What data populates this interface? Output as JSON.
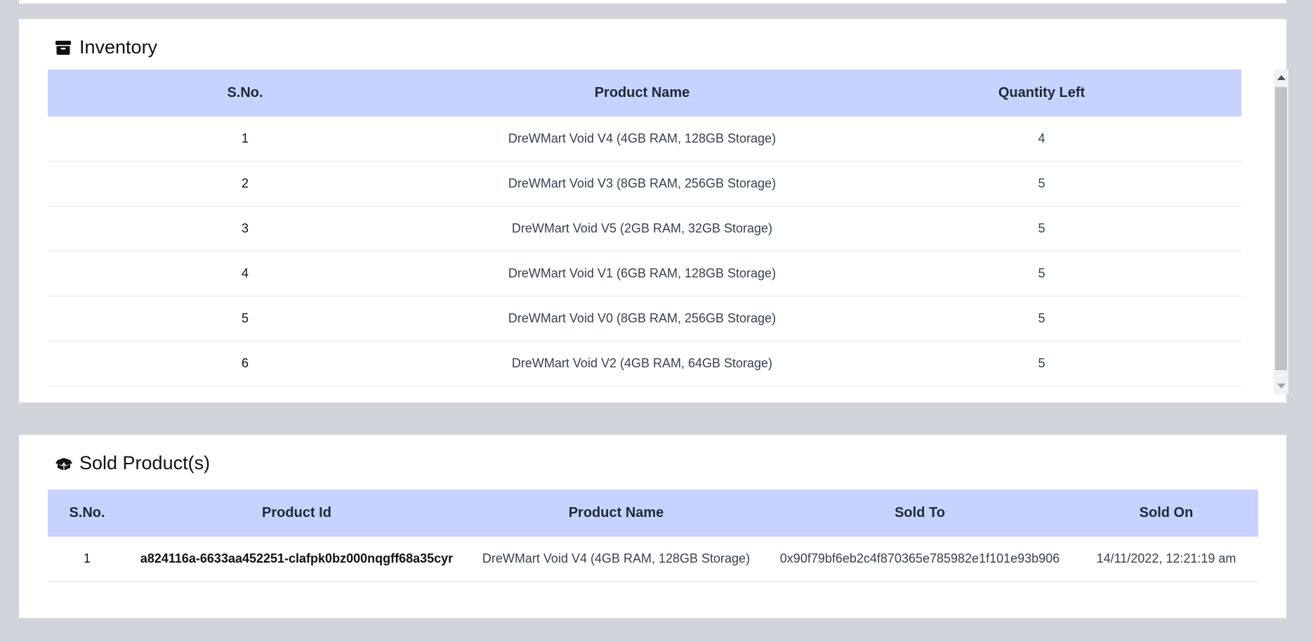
{
  "inventory": {
    "title": "Inventory",
    "icon": "archive-box-icon",
    "columns": [
      "S.No.",
      "Product Name",
      "Quantity Left"
    ],
    "rows": [
      {
        "sn": "1",
        "name": "DreWMart Void V4 (4GB RAM, 128GB Storage)",
        "qty": "4"
      },
      {
        "sn": "2",
        "name": "DreWMart Void V3 (8GB RAM, 256GB Storage)",
        "qty": "5"
      },
      {
        "sn": "3",
        "name": "DreWMart Void V5 (2GB RAM, 32GB Storage)",
        "qty": "5"
      },
      {
        "sn": "4",
        "name": "DreWMart Void V1 (6GB RAM, 128GB Storage)",
        "qty": "5"
      },
      {
        "sn": "5",
        "name": "DreWMart Void V0 (8GB RAM, 256GB Storage)",
        "qty": "5"
      },
      {
        "sn": "6",
        "name": "DreWMart Void V2 (4GB RAM, 64GB Storage)",
        "qty": "5"
      }
    ]
  },
  "sold": {
    "title": "Sold Product(s)",
    "icon": "open-box-icon",
    "columns": [
      "S.No.",
      "Product Id",
      "Product Name",
      "Sold To",
      "Sold On"
    ],
    "rows": [
      {
        "sn": "1",
        "id": "a824116a-6633aa452251-clafpk0bz000nqgff68a35cyr",
        "name": "DreWMart Void V4 (4GB RAM, 128GB Storage)",
        "to": "0x90f79bf6eb2c4f870365e785982e1f101e93b906",
        "on": "14/11/2022, 12:21:19 am"
      }
    ]
  },
  "colors": {
    "page_bg": "#d1d5db",
    "card_bg": "#ffffff",
    "header_bg": "#c7d2fe"
  }
}
